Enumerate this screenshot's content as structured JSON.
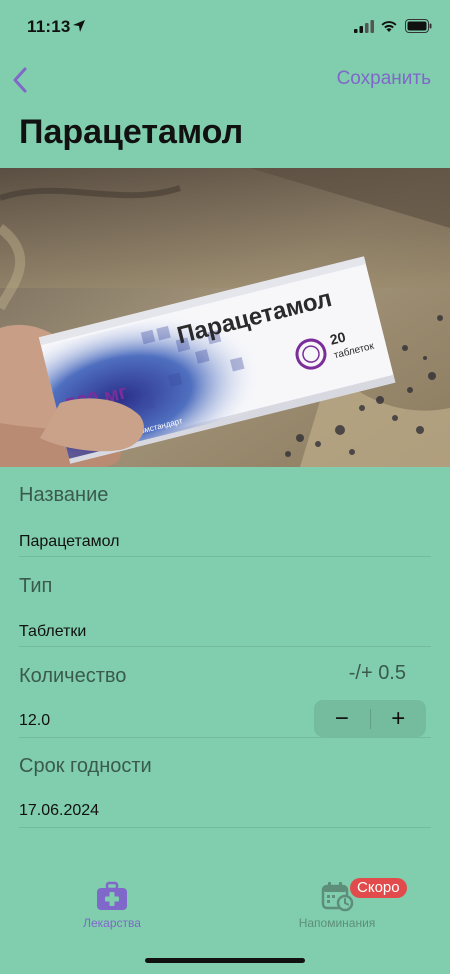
{
  "status_bar": {
    "time": "11:13"
  },
  "nav": {
    "save_label": "Сохранить"
  },
  "title": "Парацетамол",
  "photo": {
    "box_name": "Парацетамол",
    "dose": "500 мг",
    "count": "20",
    "count_unit": "таблеток",
    "brand": "Фармстандарт"
  },
  "form": {
    "name_label": "Название",
    "name_value": "Парацетамол",
    "type_label": "Тип",
    "type_value": "Таблетки",
    "quantity_label": "Количество",
    "quantity_value": "12.0",
    "step_hint": "-/+ 0.5",
    "minus": "−",
    "plus": "+",
    "expiry_label": "Срок годности",
    "expiry_value": "17.06.2024"
  },
  "tab_bar": {
    "meds_label": "Лекарства",
    "reminders_label": "Напоминания",
    "soon_badge": "Скоро"
  },
  "colors": {
    "background": "#80cead",
    "accent": "#7f68c9",
    "badge": "#e24b4b"
  }
}
